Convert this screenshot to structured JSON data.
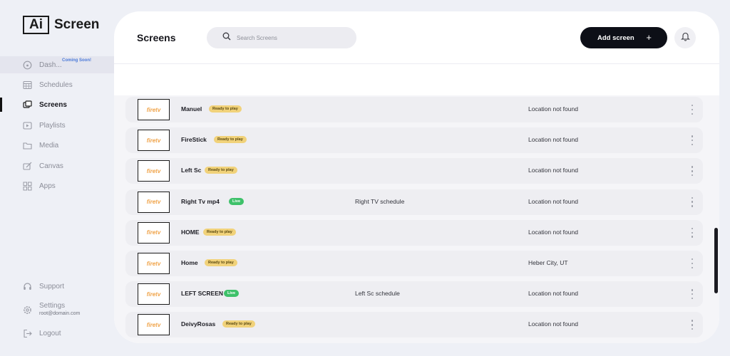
{
  "logo": {
    "boxed": "Ai",
    "text": "Screen"
  },
  "sidebar": {
    "items": [
      {
        "label": "Dash...",
        "icon": "dashboard-icon",
        "badge": "Coming Soon!"
      },
      {
        "label": "Schedules",
        "icon": "schedule-icon"
      },
      {
        "label": "Screens",
        "icon": "screens-icon",
        "active": true
      },
      {
        "label": "Playlists",
        "icon": "playlist-icon"
      },
      {
        "label": "Media",
        "icon": "folder-icon"
      },
      {
        "label": "Canvas",
        "icon": "canvas-icon"
      },
      {
        "label": "Apps",
        "icon": "apps-icon"
      }
    ],
    "bottom": {
      "support": "Support",
      "settings": "Settings",
      "email": "root@domain.com",
      "logout": "Logout"
    }
  },
  "header": {
    "title": "Screens",
    "search_placeholder": "Search Screens",
    "add_button": "Add screen",
    "add_icon": "+"
  },
  "thumb_label": "firetv",
  "screens": [
    {
      "name": "Manuel",
      "status": "Ready to play",
      "status_type": "ready",
      "schedule": "",
      "location": "Location not found"
    },
    {
      "name": "FireStick",
      "status": "Ready to play",
      "status_type": "ready",
      "schedule": "",
      "location": "Location not found"
    },
    {
      "name": "Left Sc",
      "status": "Ready to play",
      "status_type": "ready",
      "schedule": "",
      "location": "Location not found"
    },
    {
      "name": "Right Tv mp4",
      "status": "Live",
      "status_type": "live",
      "schedule": "Right TV schedule",
      "location": "Location not found"
    },
    {
      "name": "HOME",
      "status": "Ready to play",
      "status_type": "ready",
      "schedule": "",
      "location": "Location not found"
    },
    {
      "name": "Home",
      "status": "Ready to play",
      "status_type": "ready",
      "schedule": "",
      "location": "Heber City, UT"
    },
    {
      "name": "LEFT SCREEN",
      "status": "Live",
      "status_type": "live",
      "schedule": "Left Sc schedule",
      "location": "Location not found"
    },
    {
      "name": "DeivyRosas",
      "status": "Ready to play",
      "status_type": "ready",
      "schedule": "",
      "location": "Location not found"
    }
  ],
  "colors": {
    "ready_badge": "#f1d27a",
    "live_badge": "#3ec16a",
    "accent_dark": "#0d0f17",
    "coming_soon": "#4a79d9"
  }
}
